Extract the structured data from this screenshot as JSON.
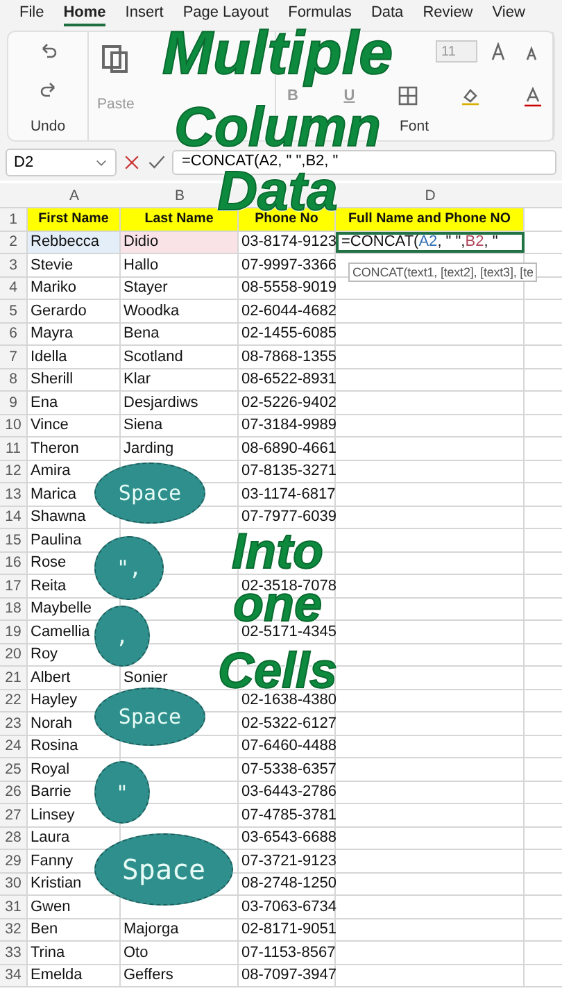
{
  "menu_tabs": [
    {
      "label": "File",
      "selected": false
    },
    {
      "label": "Home",
      "selected": true
    },
    {
      "label": "Insert",
      "selected": false
    },
    {
      "label": "Page Layout",
      "selected": false
    },
    {
      "label": "Formulas",
      "selected": false
    },
    {
      "label": "Data",
      "selected": false
    },
    {
      "label": "Review",
      "selected": false
    },
    {
      "label": "View",
      "selected": false
    }
  ],
  "ribbon": {
    "font_size": "11",
    "groups": [
      "Undo",
      "Font"
    ],
    "paste_label": "Paste",
    "bold_label": "B",
    "underline_label": "U"
  },
  "formula_bar": {
    "name_box": "D2",
    "formula": "=CONCAT(A2, \" \",B2, \""
  },
  "columns": [
    {
      "label": "A"
    },
    {
      "label": "B"
    },
    {},
    {
      "label": "D"
    }
  ],
  "header_row": {
    "number": "1",
    "cells": [
      "First Name",
      "Last Name",
      "Phone No",
      "Full Name and Phone NO"
    ]
  },
  "edit_row": {
    "number": "2",
    "first": "Rebbecca",
    "last": "Didio",
    "phone": "03-8174-9123",
    "formula_parts": [
      {
        "text": "=CONCAT("
      },
      {
        "text": "A2",
        "color": "#2f6fb5"
      },
      {
        "text": ", \" \","
      },
      {
        "text": "B2",
        "color": "#b0445a"
      },
      {
        "text": ", \""
      }
    ],
    "tooltip": "CONCAT(text1, [text2], [text3], [te"
  },
  "rows": [
    {
      "number": "3",
      "first": "Stevie",
      "last": "Hallo",
      "phone": "07-9997-3366"
    },
    {
      "number": "4",
      "first": "Mariko",
      "last": "Stayer",
      "phone": "08-5558-9019"
    },
    {
      "number": "5",
      "first": "Gerardo",
      "last": "Woodka",
      "phone": "02-6044-4682"
    },
    {
      "number": "6",
      "first": "Mayra",
      "last": "Bena",
      "phone": "02-1455-6085"
    },
    {
      "number": "7",
      "first": "Idella",
      "last": "Scotland",
      "phone": "08-7868-1355"
    },
    {
      "number": "8",
      "first": "Sherill",
      "last": "Klar",
      "phone": "08-6522-8931"
    },
    {
      "number": "9",
      "first": "Ena",
      "last": "Desjardiws",
      "phone": "02-5226-9402"
    },
    {
      "number": "10",
      "first": "Vince",
      "last": "Siena",
      "phone": "07-3184-9989"
    },
    {
      "number": "11",
      "first": "Theron",
      "last": "Jarding",
      "phone": "08-6890-4661"
    },
    {
      "number": "12",
      "first": "Amira",
      "phone": "07-8135-3271"
    },
    {
      "number": "13",
      "first": "Marica",
      "phone": "03-1174-6817"
    },
    {
      "number": "14",
      "first": "Shawna",
      "phone": "07-7977-6039"
    },
    {
      "number": "15",
      "first": "Paulina"
    },
    {
      "number": "16",
      "first": "Rose"
    },
    {
      "number": "17",
      "first": "Reita",
      "phone": "02-3518-7078"
    },
    {
      "number": "18",
      "first": "Maybelle"
    },
    {
      "number": "19",
      "first": "Camellia",
      "phone": "02-5171-4345"
    },
    {
      "number": "20",
      "first": "Roy"
    },
    {
      "number": "21",
      "first": "Albert",
      "last": "Sonier"
    },
    {
      "number": "22",
      "first": "Hayley",
      "phone": "02-1638-4380"
    },
    {
      "number": "23",
      "first": "Norah",
      "phone": "02-5322-6127"
    },
    {
      "number": "24",
      "first": "Rosina",
      "phone": "07-6460-4488"
    },
    {
      "number": "25",
      "first": "Royal",
      "phone": "07-5338-6357"
    },
    {
      "number": "26",
      "first": "Barrie",
      "phone": "03-6443-2786"
    },
    {
      "number": "27",
      "first": "Linsey",
      "phone": "07-4785-3781"
    },
    {
      "number": "28",
      "first": "Laura",
      "phone": "03-6543-6688"
    },
    {
      "number": "29",
      "first": "Fanny",
      "phone": "07-3721-9123"
    },
    {
      "number": "30",
      "first": "Kristian",
      "phone": "08-2748-1250"
    },
    {
      "number": "31",
      "first": "Gwen",
      "phone": "03-7063-6734"
    },
    {
      "number": "32",
      "first": "Ben",
      "last": "Majorga",
      "phone": "02-8171-9051"
    },
    {
      "number": "33",
      "first": "Trina",
      "last": "Oto",
      "phone": "07-1153-8567"
    },
    {
      "number": "34",
      "first": "Emelda",
      "last": "Geffers",
      "phone": "08-7097-3947"
    }
  ],
  "overlay": {
    "title_lines": [
      "Multiple",
      "Column",
      "Data"
    ],
    "subtitle_lines": [
      "Into",
      "one",
      "Cells"
    ],
    "bubbles": [
      {
        "text": "Space"
      },
      {
        "text": "\","
      },
      {
        "text": ","
      },
      {
        "text": "Space"
      },
      {
        "text": "\""
      },
      {
        "text": "Space"
      }
    ]
  }
}
